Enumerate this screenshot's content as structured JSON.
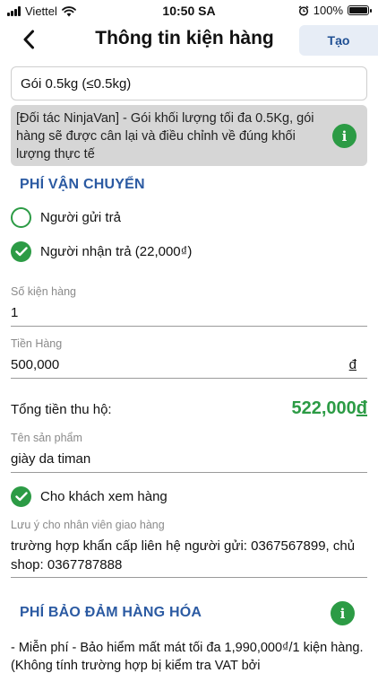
{
  "status_bar": {
    "carrier": "Viettel",
    "time": "10:50 SA",
    "battery": "100%",
    "battery_level": 1.0
  },
  "header": {
    "title": "Thông tin kiện hàng",
    "create_label": "Tạo"
  },
  "package": {
    "selected": "Gói 0.5kg (≤0.5kg)",
    "notice": "[Đối tác NinjaVan] - Gói khối lượng tối đa 0.5Kg, gói hàng sẽ được cân lại và điều chỉnh về đúng khối lượng thực tế"
  },
  "shipping_fee": {
    "title": "PHÍ VẬN CHUYỂN",
    "options": [
      {
        "label": "Người gửi trả",
        "selected": false
      },
      {
        "label": "Người nhận trả (22,000₫)",
        "selected": true
      }
    ]
  },
  "form": {
    "quantity": {
      "label": "Số kiện hàng",
      "value": "1"
    },
    "goods_value": {
      "label": "Tiền Hàng",
      "value": "500,000",
      "currency": "đ"
    },
    "total": {
      "label": "Tổng tiền thu hộ:",
      "amount": "522,000",
      "currency": "đ"
    },
    "product_name": {
      "label": "Tên sản phẩm",
      "value": "giày da timan"
    },
    "allow_inspect": {
      "label": "Cho khách xem hàng",
      "checked": true
    },
    "delivery_note": {
      "label": "Lưu ý cho nhân viên giao hàng",
      "value": "trường hợp khẩn cấp liên hệ người gửi: 0367567899, chủ shop: 0367787888"
    }
  },
  "insurance": {
    "title": "PHÍ BẢO ĐẢM HÀNG HÓA",
    "description": "- Miễn phí - Bảo hiểm mất mát tối đa 1,990,000₫/1 kiện hàng.(Không tính trường hợp bị kiểm tra VAT bởi"
  },
  "icons": {
    "info": "i",
    "accent_green": "#2c9b45",
    "accent_blue": "#2b5aa2"
  }
}
